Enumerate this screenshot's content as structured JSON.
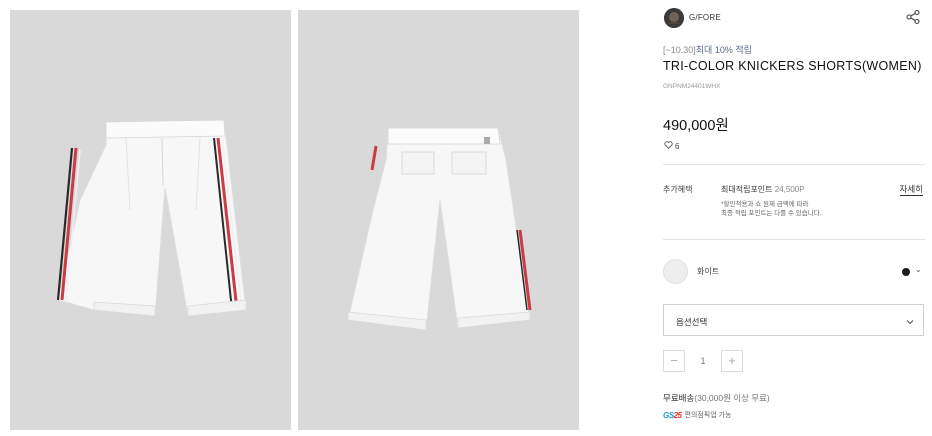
{
  "gallery": {
    "images": [
      {
        "alt": "front-view"
      },
      {
        "alt": "back-view"
      }
    ]
  },
  "product": {
    "brand": "G/FORE",
    "promo_date": "[~10.30]",
    "promo_text": "최대 10% 적립",
    "title": "TRI-COLOR KNICKERS SHORTS(WOMEN)",
    "code": "GNPNM24401WHX",
    "price": "490,000원",
    "likes": "6"
  },
  "benefits": {
    "label": "추가혜택",
    "main": "최대적립포인트",
    "points": "24,500P",
    "detail_link": "자세히",
    "note_line1": "*할인적용과 쇼 원제 금액에 따라",
    "note_line2": "최종 적립 포인트는 다를 수 있습니다."
  },
  "color": {
    "name": "화이트",
    "chevron": "⌄",
    "dot_color": "#1c1c1c"
  },
  "option": {
    "label": "옵션선택"
  },
  "quantity": {
    "minus": "−",
    "value": "1",
    "plus": "+"
  },
  "shipping": {
    "text": "무료배송",
    "condition": "(30,000원 이상 무료)"
  },
  "pickup": {
    "logo_gs": "GS",
    "logo_num": "25",
    "text": "편의점픽업 가능"
  },
  "icons": {
    "share": "share-icon",
    "heart": "heart-icon",
    "chevron": "chevron-down-icon"
  }
}
